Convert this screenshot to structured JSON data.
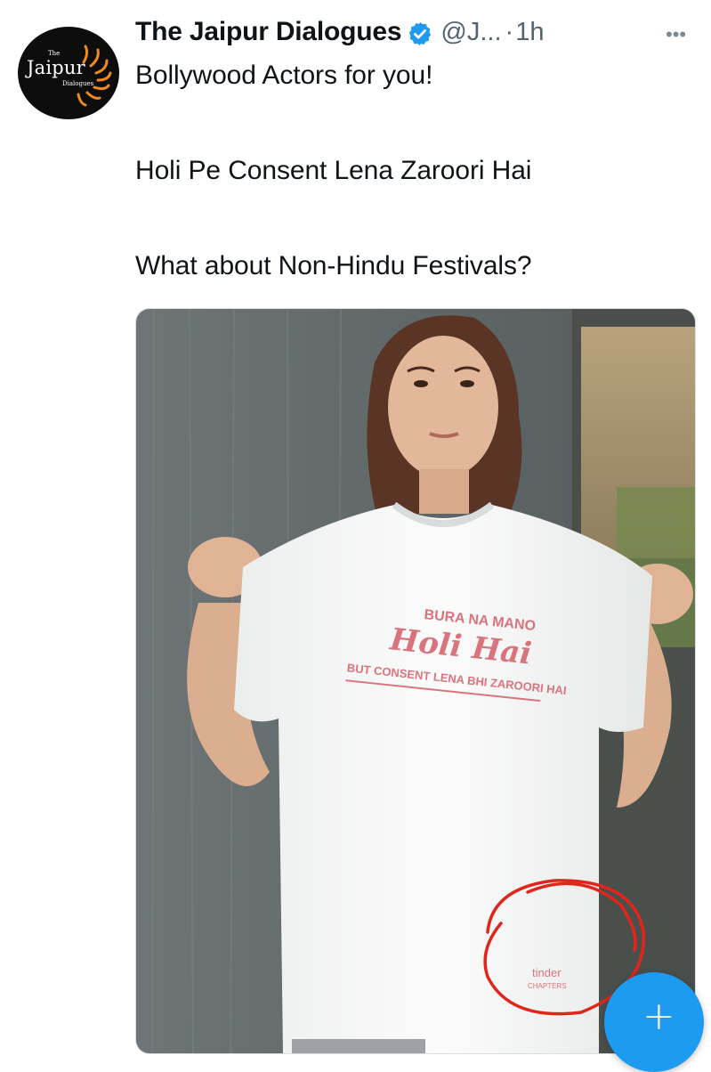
{
  "author": {
    "display_name": "The Jaipur Dialogues",
    "handle": "@J...",
    "separator": "·",
    "time": "1h",
    "verified": true,
    "avatar_brand": {
      "small_top": "The",
      "main": "Jaipur",
      "small_bottom": "Dialogues"
    }
  },
  "tweet": {
    "lines": [
      "Bollywood Actors for you!",
      "Holi Pe Consent Lena Zaroori Hai",
      "What about Non-Hindu Festivals?"
    ]
  },
  "media": {
    "tshirt_text": {
      "top": "BURA NA MANO",
      "middle": "Holi Hai",
      "bottom": "BUT CONSENT LENA BHI ZAROORI HAI",
      "tag_line1": "tinder",
      "tag_line2": "CHAPTERS"
    }
  },
  "fab": {
    "label": "+"
  },
  "colors": {
    "verified_blue": "#1d9bf0",
    "print_pink": "#d9747d",
    "annotation_red": "#e0251b",
    "fab_blue": "#1d9bf0"
  },
  "icons": [
    "verified-badge-icon",
    "more-icon",
    "plus-icon"
  ]
}
